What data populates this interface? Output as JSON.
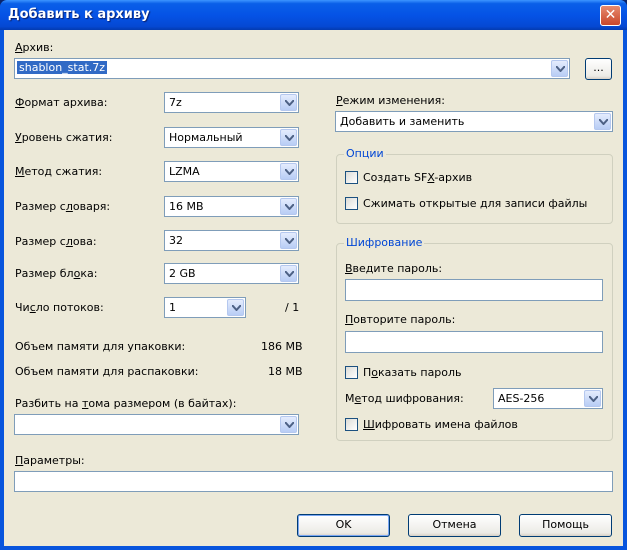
{
  "window": {
    "title": "Добавить к архиву",
    "close_label": "✕"
  },
  "archive": {
    "label_underlined": "А",
    "label_rest": "рхив:",
    "value": "shablon_stat.7z",
    "browse_label": "..."
  },
  "left": {
    "format": {
      "u": "Ф",
      "rest": "ормат архива:",
      "value": "7z"
    },
    "level": {
      "u": "У",
      "rest": "ровень сжатия:",
      "value": "Нормальный"
    },
    "method": {
      "u": "М",
      "rest": "етод сжатия:",
      "value": "LZMA"
    },
    "dict": {
      "pre": "Размер с",
      "u": "л",
      "rest": "оваря:",
      "value": "16 MB"
    },
    "word": {
      "pre": "Размер с",
      "u": "л",
      "rest": "ова:",
      "value": "32"
    },
    "block": {
      "pre": "Размер бл",
      "u": "о",
      "rest": "ка:",
      "value": "2 GB"
    },
    "threads": {
      "pre": "Чи",
      "u": "с",
      "rest": "ло потоков:",
      "value": "1",
      "max": "/ 1"
    },
    "mem_pack": {
      "label": "Объем памяти для упаковки:",
      "value": "186 MB"
    },
    "mem_unpack": {
      "label": "Объем памяти для распаковки:",
      "value": "18 MB"
    },
    "split": {
      "pre": "Разбить на ",
      "u": "т",
      "rest": "ома размером (в байтах):",
      "value": ""
    },
    "params": {
      "u": "П",
      "rest": "араметры:",
      "value": ""
    }
  },
  "right": {
    "mode": {
      "u": "Р",
      "rest": "ежим изменения:",
      "value": "Добавить и заменить"
    },
    "options": {
      "title": "Опции",
      "sfx": {
        "pre": "Создать SF",
        "u": "X",
        "rest": "-архив"
      },
      "shared": {
        "pre": "Сжимать открытые для записи файлы",
        "u": "",
        "rest": ""
      }
    },
    "encryption": {
      "title": "Шифрование",
      "enter": {
        "u": "В",
        "rest": "ведите пароль:"
      },
      "repeat": {
        "u": "П",
        "rest": "овторите пароль:"
      },
      "show": {
        "pre": "П",
        "u": "о",
        "rest": "казать пароль"
      },
      "method": {
        "pre": "М",
        "u": "е",
        "rest": "тод шифрования:",
        "value": "AES-256"
      },
      "names": {
        "u": "Ш",
        "rest": "ифровать имена файлов"
      }
    }
  },
  "buttons": {
    "ok": "OK",
    "cancel": "Отмена",
    "help": "Помощь"
  }
}
